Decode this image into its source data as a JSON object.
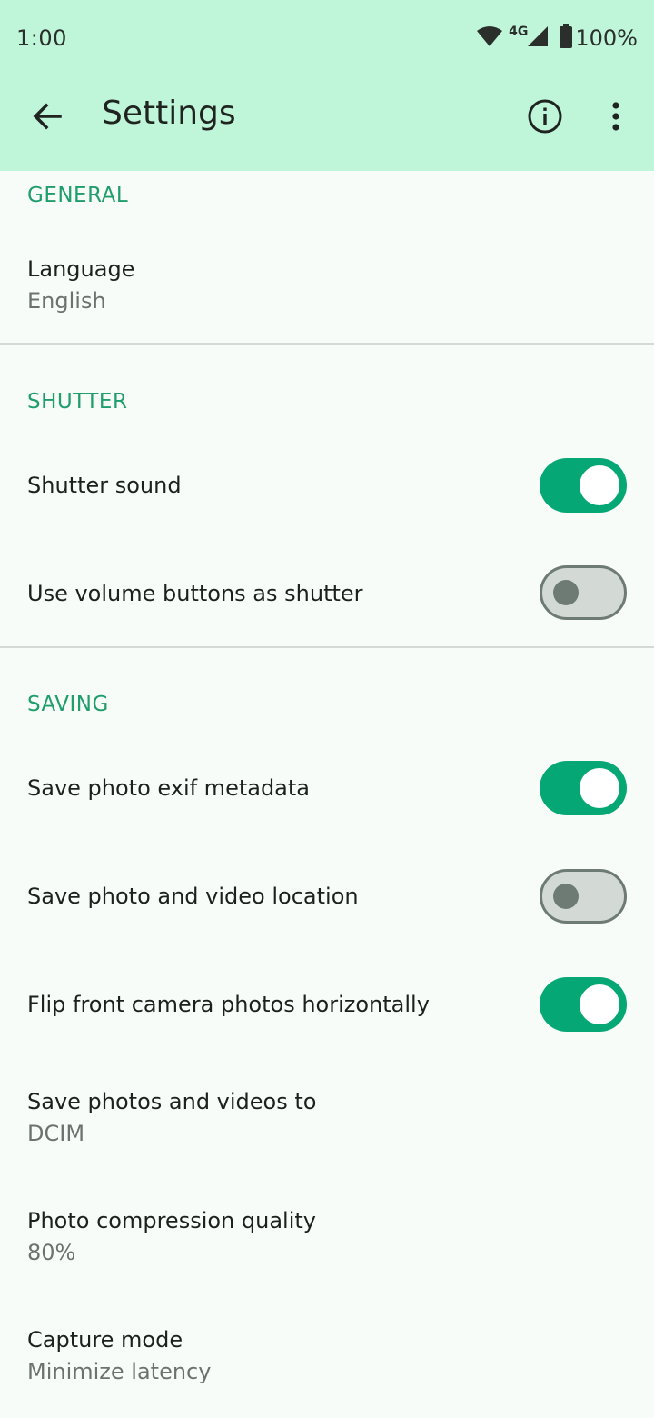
{
  "status_bar": {
    "time": "1:00",
    "network": "4G",
    "battery": "100%",
    "icons": [
      "wifi-icon",
      "signal-icon",
      "battery-icon"
    ]
  },
  "app_bar": {
    "title": "Settings",
    "back_icon": "arrow-back-icon",
    "info_icon": "info-icon",
    "more_icon": "more-vert-icon"
  },
  "sections": {
    "general": {
      "header": "GENERAL",
      "language": {
        "title": "Language",
        "value": "English"
      }
    },
    "shutter": {
      "header": "SHUTTER",
      "shutter_sound": {
        "title": "Shutter sound",
        "enabled": true
      },
      "volume_buttons": {
        "title": "Use volume buttons as shutter",
        "enabled": false
      }
    },
    "saving": {
      "header": "SAVING",
      "exif": {
        "title": "Save photo exif metadata",
        "enabled": true
      },
      "location": {
        "title": "Save photo and video location",
        "enabled": false
      },
      "flip_front": {
        "title": "Flip front camera photos horizontally",
        "enabled": true
      },
      "save_to": {
        "title": "Save photos and videos to",
        "value": "DCIM"
      },
      "compression": {
        "title": "Photo compression quality",
        "value": "80%"
      },
      "capture_mode": {
        "title": "Capture mode",
        "value": "Minimize latency"
      }
    }
  },
  "colors": {
    "app_bar_bg": "#bff5d9",
    "accent": "#05a874",
    "section_header": "#1f9e6c",
    "background": "#f8fcf9"
  }
}
